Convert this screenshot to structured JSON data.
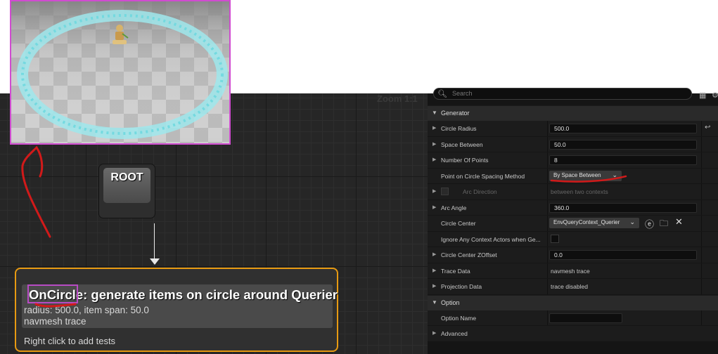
{
  "graph": {
    "zoom_label": "Zoom 1:1",
    "root_node": {
      "label": "ROOT"
    },
    "generator_node": {
      "title": "OnCircle: generate items on circle around Querier",
      "line1": "radius: 500.0, item span: 50.0",
      "line2": "navmesh trace",
      "footer": "Right click to add tests"
    }
  },
  "details": {
    "search_placeholder": "Search",
    "categories": {
      "generator": "Generator",
      "option": "Option",
      "advanced": "Advanced"
    },
    "properties": {
      "circle_radius": {
        "label": "Circle Radius",
        "value": "500.0"
      },
      "space_between": {
        "label": "Space Between",
        "value": "50.0"
      },
      "number_of_points": {
        "label": "Number Of Points",
        "value": "8"
      },
      "spacing_method": {
        "label": "Point on Circle Spacing Method",
        "value": "By Space Between"
      },
      "arc_direction": {
        "label": "Arc Direction",
        "value": "between two contexts"
      },
      "arc_angle": {
        "label": "Arc Angle",
        "value": "360.0"
      },
      "circle_center": {
        "label": "Circle Center",
        "value": "EnvQueryContext_Querier"
      },
      "ignore_context": {
        "label": "Ignore Any Context Actors when Ge...",
        "checked": false
      },
      "circle_center_zoffset": {
        "label": "Circle Center ZOffset",
        "value": "0.0"
      },
      "trace_data": {
        "label": "Trace Data",
        "value": "navmesh trace"
      },
      "projection_data": {
        "label": "Projection Data",
        "value": "trace disabled"
      },
      "option_name": {
        "label": "Option Name",
        "value": ""
      }
    }
  },
  "icons": {
    "search": "magnifier",
    "grid": "grid",
    "settings": "gear",
    "reset": "reset-arrow",
    "use_selected": "arrow-left-circle",
    "browse": "folder-search",
    "clear": "x",
    "expand": "triangle-right",
    "collapse": "triangle-down"
  },
  "colors": {
    "node_border": "#e79a12",
    "viewport_border": "#d04cd0",
    "annotation": "#d11a1a",
    "circle_items": "#8ee8ee"
  }
}
